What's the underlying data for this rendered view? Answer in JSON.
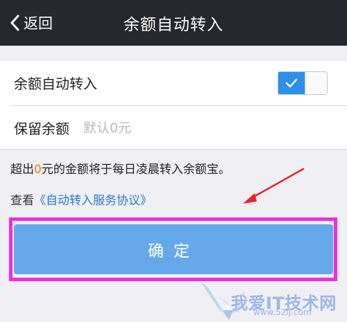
{
  "navbar": {
    "back_label": "返回",
    "title": "余额自动转入"
  },
  "settings": {
    "auto_transfer_label": "余额自动转入",
    "auto_transfer_enabled": true,
    "reserve_label": "保留余额",
    "reserve_value": "",
    "reserve_placeholder": "默认0元"
  },
  "note": {
    "prefix": "超出",
    "amount": "0",
    "suffix": "元的金额将于每日凌晨转入余额宝。"
  },
  "agreement": {
    "prefix": "查看",
    "link": "《自动转入服务协议》"
  },
  "confirm_label": "确定",
  "watermark": {
    "text": "我爱IT技术网",
    "site": "www.52ij.com"
  },
  "colors": {
    "navbar": "#27272f",
    "accent": "#2d8fe8",
    "button": "#66a9ea",
    "highlight_frame": "#f02ddf",
    "annotation_arrow": "#e8232b",
    "amount": "#ff7a00",
    "link": "#2878d6"
  }
}
